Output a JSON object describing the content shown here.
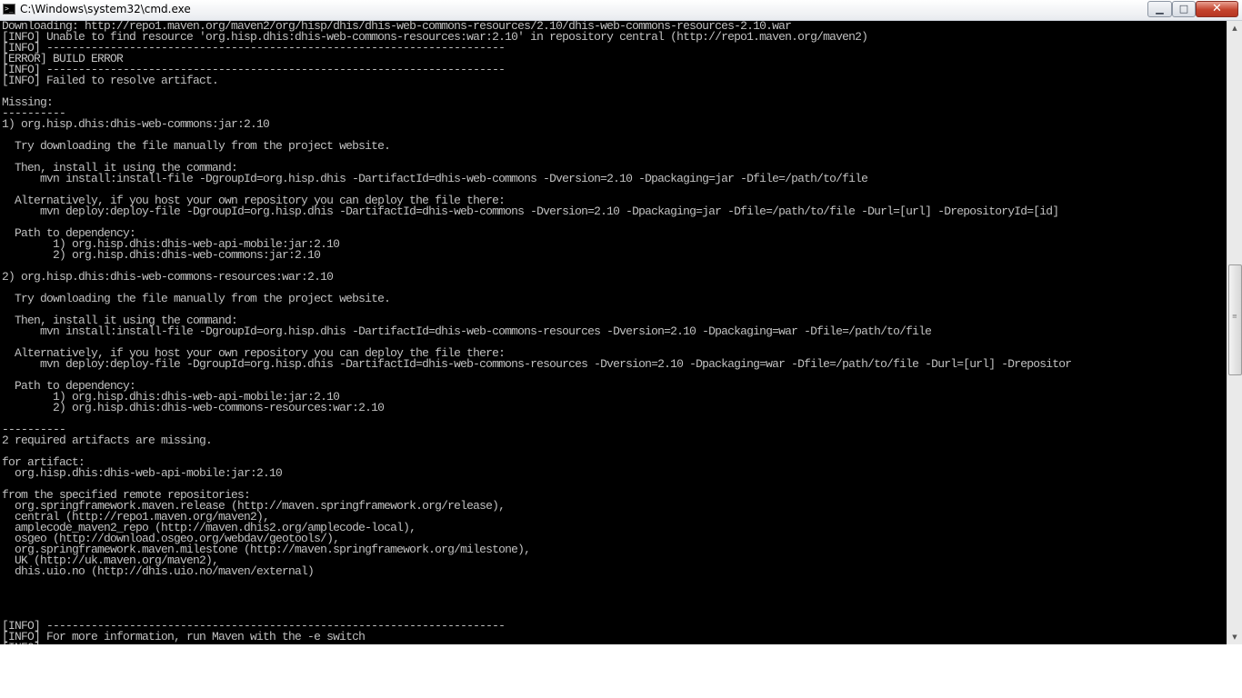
{
  "window": {
    "title": "C:\\Windows\\system32\\cmd.exe",
    "minimize_label": "▁",
    "maximize_label": "□",
    "close_label": "✕"
  },
  "console": {
    "lines": [
      "Downloading: http://repo1.maven.org/maven2/org/hisp/dhis/dhis-web-commons-resources/2.10/dhis-web-commons-resources-2.10.war",
      "[INFO] Unable to find resource 'org.hisp.dhis:dhis-web-commons-resources:war:2.10' in repository central (http://repo1.maven.org/maven2)",
      "[INFO] ------------------------------------------------------------------------",
      "[ERROR] BUILD ERROR",
      "[INFO] ------------------------------------------------------------------------",
      "[INFO] Failed to resolve artifact.",
      "",
      "Missing:",
      "----------",
      "1) org.hisp.dhis:dhis-web-commons:jar:2.10",
      "",
      "  Try downloading the file manually from the project website.",
      "",
      "  Then, install it using the command:",
      "      mvn install:install-file -DgroupId=org.hisp.dhis -DartifactId=dhis-web-commons -Dversion=2.10 -Dpackaging=jar -Dfile=/path/to/file",
      "",
      "  Alternatively, if you host your own repository you can deploy the file there:",
      "      mvn deploy:deploy-file -DgroupId=org.hisp.dhis -DartifactId=dhis-web-commons -Dversion=2.10 -Dpackaging=jar -Dfile=/path/to/file -Durl=[url] -DrepositoryId=[id]",
      "",
      "  Path to dependency:",
      "        1) org.hisp.dhis:dhis-web-api-mobile:jar:2.10",
      "        2) org.hisp.dhis:dhis-web-commons:jar:2.10",
      "",
      "2) org.hisp.dhis:dhis-web-commons-resources:war:2.10",
      "",
      "  Try downloading the file manually from the project website.",
      "",
      "  Then, install it using the command:",
      "      mvn install:install-file -DgroupId=org.hisp.dhis -DartifactId=dhis-web-commons-resources -Dversion=2.10 -Dpackaging=war -Dfile=/path/to/file",
      "",
      "  Alternatively, if you host your own repository you can deploy the file there:",
      "      mvn deploy:deploy-file -DgroupId=org.hisp.dhis -DartifactId=dhis-web-commons-resources -Dversion=2.10 -Dpackaging=war -Dfile=/path/to/file -Durl=[url] -Drepositor",
      "",
      "  Path to dependency:",
      "        1) org.hisp.dhis:dhis-web-api-mobile:jar:2.10",
      "        2) org.hisp.dhis:dhis-web-commons-resources:war:2.10",
      "",
      "----------",
      "2 required artifacts are missing.",
      "",
      "for artifact:",
      "  org.hisp.dhis:dhis-web-api-mobile:jar:2.10",
      "",
      "from the specified remote repositories:",
      "  org.springframework.maven.release (http://maven.springframework.org/release),",
      "  central (http://repo1.maven.org/maven2),",
      "  amplecode_maven2_repo (http://maven.dhis2.org/amplecode-local),",
      "  osgeo (http://download.osgeo.org/webdav/geotools/),",
      "  org.springframework.maven.milestone (http://maven.springframework.org/milestone),",
      "  UK (http://uk.maven.org/maven2),",
      "  dhis.uio.no (http://dhis.uio.no/maven/external)",
      "",
      "",
      "",
      "",
      "[INFO] ------------------------------------------------------------------------",
      "[INFO] For more information, run Maven with the -e switch",
      "[INFO] ------------------------------------------------------------------------"
    ]
  },
  "colors": {
    "console_bg": "#000000",
    "console_fg": "#c0c0c0",
    "close_button": "#c4432d"
  },
  "icons": {
    "window_icon": "cmd-icon",
    "scroll_up": "arrow-up-icon",
    "scroll_down": "arrow-down-icon"
  }
}
